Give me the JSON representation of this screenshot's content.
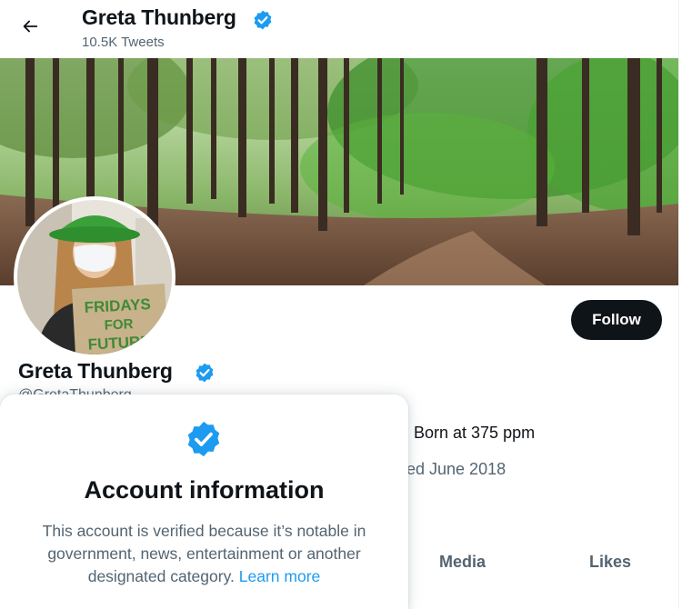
{
  "colors": {
    "accent": "#1d9bf0",
    "text_primary": "#0f1419",
    "text_secondary": "#536471",
    "follow_bg": "#0f1419"
  },
  "header": {
    "back_icon": "arrow-left-icon",
    "name": "Greta Thunberg",
    "verified_icon": "verified-badge-icon",
    "tweet_count": "10.5K Tweets"
  },
  "profile": {
    "banner_alt": "forest panorama",
    "name": "Greta Thunberg",
    "handle": "@GretaThunberg",
    "follow_label": "Follow",
    "bio_visible": "Born at 375 ppm",
    "joined_visible": "ed June 2018"
  },
  "tabs": [
    {
      "label": "Media"
    },
    {
      "label": "Likes"
    }
  ],
  "popover": {
    "icon": "verified-badge-icon",
    "title": "Account information",
    "text": "This account is verified because it’s notable in government, news, entertainment or another designated category.",
    "link": "Learn more"
  }
}
